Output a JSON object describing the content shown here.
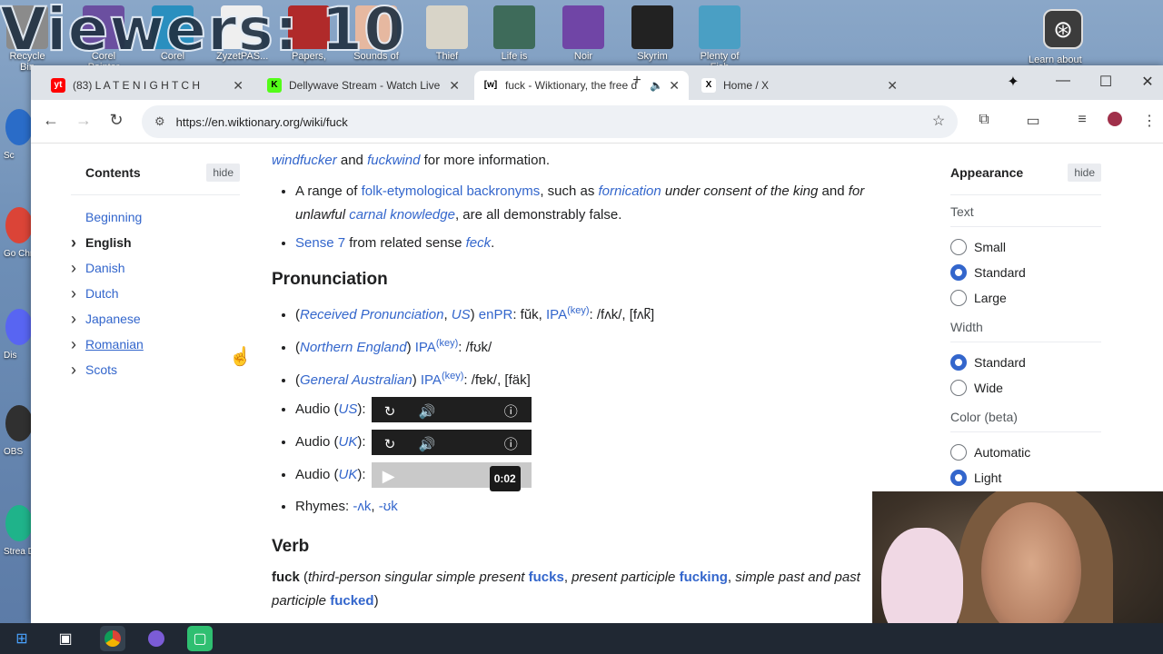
{
  "overlay": {
    "viewers_text": "Viewers: 10"
  },
  "desktop": {
    "icons": [
      {
        "label": "Recycle Bin",
        "color": "#8b8b8b"
      },
      {
        "label": "Corel Painter",
        "color": "#6b4fa0"
      },
      {
        "label": "Corel",
        "color": "#2a8fbf"
      },
      {
        "label": "ZyzetPAS...",
        "color": "#efefef"
      },
      {
        "label": "Papers,",
        "color": "#b02a2a"
      },
      {
        "label": "Sounds of",
        "color": "#e6b8a0"
      },
      {
        "label": "Thief",
        "color": "#d8d4c8"
      },
      {
        "label": "Life is",
        "color": "#3e6b5a"
      },
      {
        "label": "Noir",
        "color": "#7045a6"
      },
      {
        "label": "Skyrim",
        "color": "#222222"
      },
      {
        "label": "Plenty of Fish",
        "color": "#4a9fc4"
      }
    ],
    "learn_label": "Learn about",
    "left_labels": [
      "Sc",
      "Go Chr",
      "Dis",
      "OBS",
      "Strea De"
    ]
  },
  "browser": {
    "tabs": [
      {
        "title": "(83) L A T E N I G H T  C H",
        "favicon": "yt",
        "active": false
      },
      {
        "title": "Dellywave Stream - Watch Live",
        "favicon": "K",
        "active": false
      },
      {
        "title": "fuck - Wiktionary, the free d",
        "favicon": "[w]",
        "active": true
      },
      {
        "title": "Home / X",
        "favicon": "X",
        "active": false
      }
    ],
    "new_tab": "+",
    "url": "https://en.wiktionary.org/wiki/fuck"
  },
  "toc": {
    "title": "Contents",
    "hide": "hide",
    "items": [
      {
        "label": "Beginning",
        "expandable": false
      },
      {
        "label": "English",
        "expandable": true
      },
      {
        "label": "Danish",
        "expandable": true
      },
      {
        "label": "Dutch",
        "expandable": true
      },
      {
        "label": "Japanese",
        "expandable": true
      },
      {
        "label": "Romanian",
        "expandable": true
      },
      {
        "label": "Scots",
        "expandable": true
      }
    ]
  },
  "article": {
    "line1": {
      "a": "windfucker",
      "and": " and ",
      "b": "fuckwind",
      "rest": " for more information."
    },
    "bullet1": {
      "pre": "A range of ",
      "link": "folk-etymological backronyms",
      "mid": ", such as ",
      "fornication": "fornication",
      "consent": " under consent of the king",
      "and": " and ",
      "unlawful": "for unlawful ",
      "carnal": "carnal knowledge",
      "tail": ", are all demonstrably false."
    },
    "bullet2": {
      "link": "Sense 7",
      "mid": " from related sense ",
      "feck": "feck",
      "dot": "."
    },
    "pron_heading": "Pronunciation",
    "pron": [
      {
        "region": "Received Pronunciation",
        "sep": ", ",
        "region2": "US",
        "enpr_label": "enPR",
        "enpr": ": fŭk, ",
        "ipa": "IPA",
        "key": "(key)",
        "val": ": /fʌk/, [fʌk̚]"
      },
      {
        "region": "Northern England",
        "ipa": "IPA",
        "key": "(key)",
        "val": ": /fʊk/"
      },
      {
        "region": "General Australian",
        "ipa": "IPA",
        "key": "(key)",
        "val": ": /fɐk/, [fäk]"
      }
    ],
    "audio": [
      {
        "label": "Audio (",
        "region": "US",
        "close": "):"
      },
      {
        "label": "Audio (",
        "region": "UK",
        "close": "):"
      },
      {
        "label": "Audio (",
        "region": "UK",
        "close": "):",
        "time": "0:02"
      }
    ],
    "rhymes": {
      "label": "Rhymes: ",
      "a": "-ʌk",
      "sep": ", ",
      "b": "-ʊk"
    },
    "verb_heading": "Verb",
    "verb": {
      "word": "fuck",
      "p1": " (",
      "tp": "third-person singular simple present",
      "fucks": "fucks",
      "c1": ", ",
      "pp": "present participle",
      "fucking": "fucking",
      "c2": ", ",
      "sp": "simple past and past participle",
      "fucked": "fucked",
      "p2": ")"
    }
  },
  "appearance": {
    "title": "Appearance",
    "hide": "hide",
    "text_label": "Text",
    "text_options": [
      {
        "label": "Small",
        "on": false
      },
      {
        "label": "Standard",
        "on": true
      },
      {
        "label": "Large",
        "on": false
      }
    ],
    "width_label": "Width",
    "width_options": [
      {
        "label": "Standard",
        "on": true
      },
      {
        "label": "Wide",
        "on": false
      }
    ],
    "color_label": "Color (beta)",
    "color_options": [
      {
        "label": "Automatic",
        "on": false
      },
      {
        "label": "Light",
        "on": true
      }
    ]
  }
}
